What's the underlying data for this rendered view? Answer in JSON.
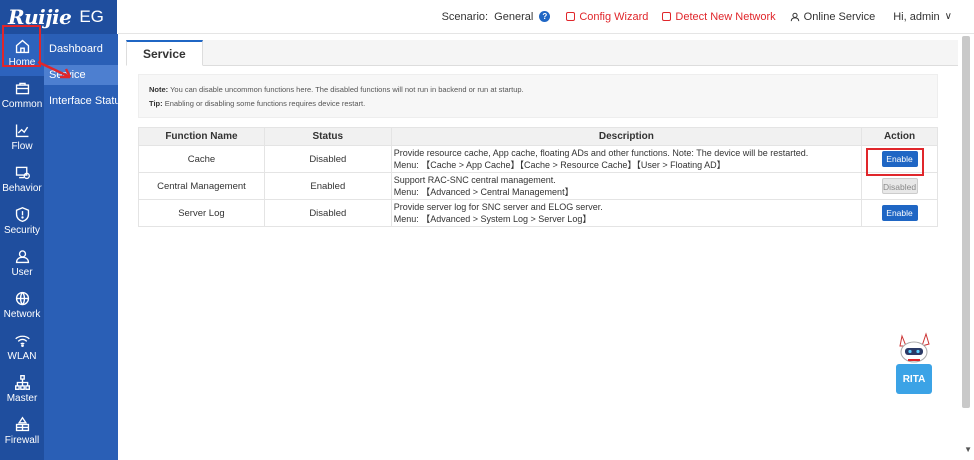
{
  "brand": {
    "logo": "Ruijie",
    "model": "EG"
  },
  "rail": [
    {
      "label": "Home",
      "icon": "home-icon"
    },
    {
      "label": "Common",
      "icon": "briefcase-icon"
    },
    {
      "label": "Flow",
      "icon": "chart-icon"
    },
    {
      "label": "Behavior",
      "icon": "behavior-icon"
    },
    {
      "label": "Security",
      "icon": "shield-icon"
    },
    {
      "label": "User",
      "icon": "user-icon"
    },
    {
      "label": "Network",
      "icon": "globe-icon"
    },
    {
      "label": "WLAN",
      "icon": "wifi-icon"
    },
    {
      "label": "Master",
      "icon": "topology-icon"
    },
    {
      "label": "Firewall",
      "icon": "firewall-icon"
    }
  ],
  "subnav": [
    {
      "label": "Dashboard"
    },
    {
      "label": "Service"
    },
    {
      "label": "Interface Status"
    }
  ],
  "topbar": {
    "scenario": "Scenario:  General",
    "config_wizard": "Config Wizard",
    "detect_network": "Detect New Network",
    "online_service": "Online Service",
    "user": "Hi, admin"
  },
  "page": {
    "tab": "Service",
    "note_label": "Note:",
    "note_text": " You can disable uncommon functions here. The disabled functions will not run in backend or run at startup.",
    "tip_label": "Tip:",
    "tip_text": " Enabling or disabling some functions requires device restart."
  },
  "table": {
    "headers": [
      "Function Name",
      "Status",
      "Description",
      "Action"
    ],
    "rows": [
      {
        "name": "Cache",
        "status": "Disabled",
        "desc1": "Provide resource cache, App cache, floating ADs and other functions. Note: The device will be restarted.",
        "desc2": "Menu: 【Cache > App Cache】【Cache > Resource Cache】【User > Floating AD】",
        "action": "Enable"
      },
      {
        "name": "Central Management",
        "status": "Enabled",
        "desc1": "Support RAC-SNC central management.",
        "desc2": "Menu: 【Advanced > Central Management】",
        "action": "Disabled"
      },
      {
        "name": "Server Log",
        "status": "Disabled",
        "desc1": "Provide server log for SNC server and ELOG server.",
        "desc2": "Menu: 【Advanced > System Log > Server Log】",
        "action": "Enable"
      }
    ]
  },
  "rita": {
    "label": "RITA"
  },
  "colors": {
    "primary": "#1f4e9e",
    "accent_red": "#e0262b",
    "button_blue": "#1f66c4",
    "enabled_green": "#2a9a2a"
  }
}
